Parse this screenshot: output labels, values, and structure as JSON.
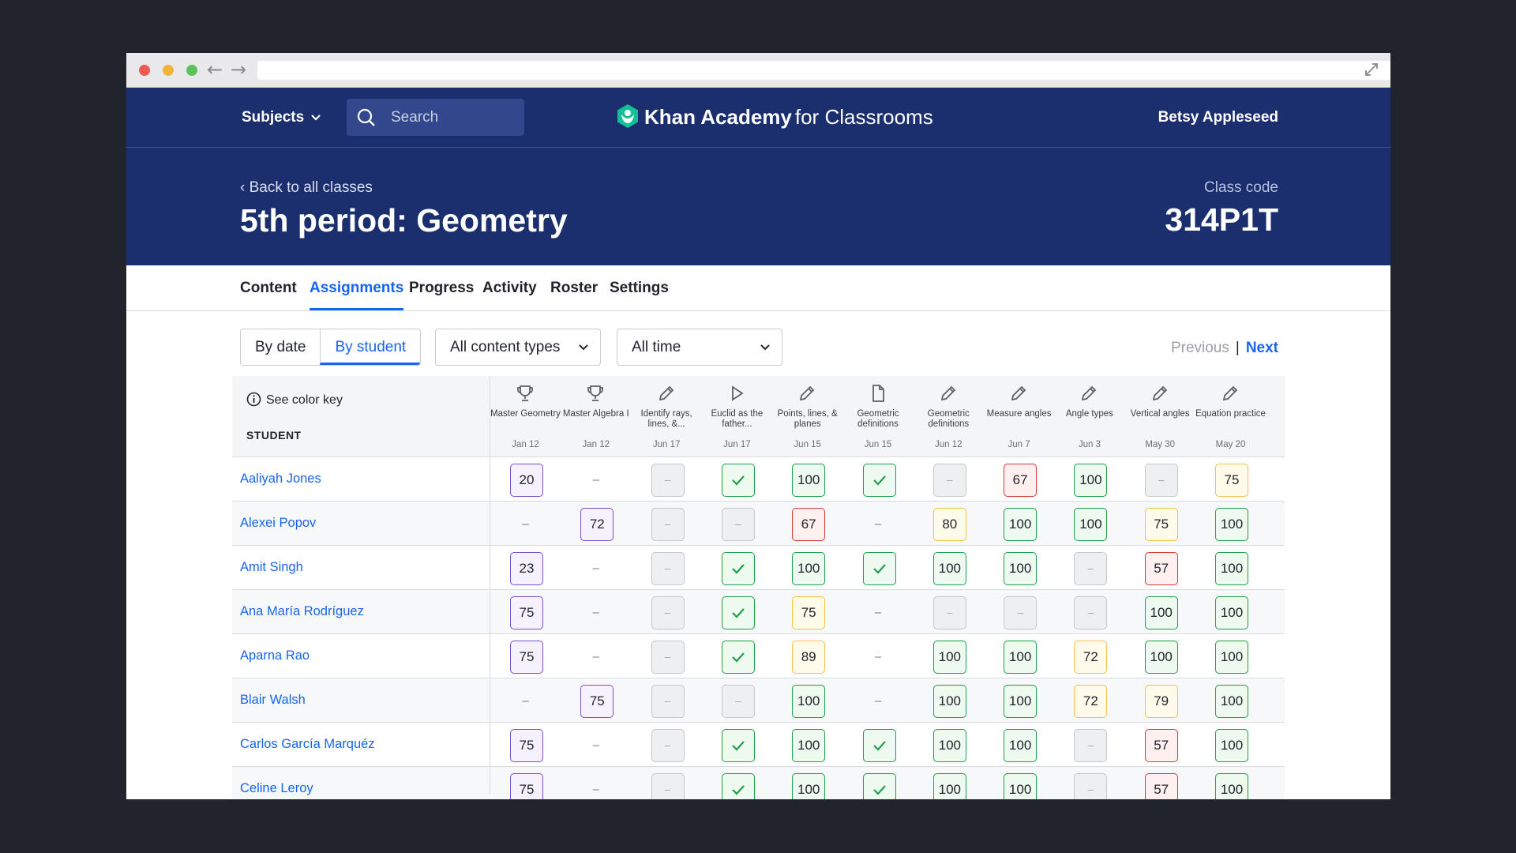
{
  "browser": {
    "url": ""
  },
  "nav": {
    "subjects": "Subjects",
    "search_placeholder": "Search",
    "brand_name": "Khan Academy",
    "brand_suffix": "for Classrooms",
    "user": "Betsy Appleseed"
  },
  "header": {
    "back": "Back to all classes",
    "title": "5th period: Geometry",
    "code_label": "Class code",
    "code_value": "314P1T"
  },
  "tabs": [
    "Content",
    "Assignments",
    "Progress",
    "Activity",
    "Roster",
    "Settings"
  ],
  "active_tab": "Assignments",
  "controls": {
    "by_date": "By date",
    "by_student": "By student",
    "content_types": "All content types",
    "time": "All time",
    "previous": "Previous",
    "separator": "|",
    "next": "Next"
  },
  "table": {
    "color_key": "See color key",
    "student_header": "STUDENT",
    "columns": [
      {
        "icon": "trophy-icon",
        "name": "Master Geometry",
        "date": "Jan 12"
      },
      {
        "icon": "trophy-icon",
        "name": "Master Algebra I",
        "date": "Jan 12"
      },
      {
        "icon": "pencil-icon",
        "name": "Identify rays, lines, &...",
        "date": "Jun 17"
      },
      {
        "icon": "play-icon",
        "name": "Euclid as the father...",
        "date": "Jun 17"
      },
      {
        "icon": "pencil-icon",
        "name": "Points, lines, & planes",
        "date": "Jun 15"
      },
      {
        "icon": "document-icon",
        "name": "Geometric definitions",
        "date": "Jun 15"
      },
      {
        "icon": "pencil-icon",
        "name": "Geometric definitions",
        "date": "Jun 12"
      },
      {
        "icon": "pencil-icon",
        "name": "Measure angles",
        "date": "Jun 7"
      },
      {
        "icon": "pencil-icon",
        "name": "Angle types",
        "date": "Jun 3"
      },
      {
        "icon": "pencil-icon",
        "name": "Vertical angles",
        "date": "May 30"
      },
      {
        "icon": "pencil-icon",
        "name": "Equation practice",
        "date": "May 20"
      }
    ],
    "rows": [
      {
        "name": "Aaliyah Jones",
        "cells": [
          [
            "purple",
            "20"
          ],
          [
            "dash",
            "–"
          ],
          [
            "gray",
            "–"
          ],
          [
            "check",
            ""
          ],
          [
            "green",
            "100"
          ],
          [
            "check",
            ""
          ],
          [
            "gray",
            "–"
          ],
          [
            "red",
            "67"
          ],
          [
            "green",
            "100"
          ],
          [
            "gray",
            "–"
          ],
          [
            "yellow",
            "75"
          ]
        ]
      },
      {
        "name": "Alexei Popov",
        "cells": [
          [
            "dash",
            "–"
          ],
          [
            "purple",
            "72"
          ],
          [
            "gray",
            "–"
          ],
          [
            "gray",
            "–"
          ],
          [
            "red",
            "67"
          ],
          [
            "dash",
            "–"
          ],
          [
            "yellow",
            "80"
          ],
          [
            "green",
            "100"
          ],
          [
            "green",
            "100"
          ],
          [
            "yellow",
            "75"
          ],
          [
            "green",
            "100"
          ]
        ]
      },
      {
        "name": "Amit Singh",
        "cells": [
          [
            "purple",
            "23"
          ],
          [
            "dash",
            "–"
          ],
          [
            "gray",
            "–"
          ],
          [
            "check",
            ""
          ],
          [
            "green",
            "100"
          ],
          [
            "check",
            ""
          ],
          [
            "green",
            "100"
          ],
          [
            "green",
            "100"
          ],
          [
            "gray",
            "–"
          ],
          [
            "red",
            "57"
          ],
          [
            "green",
            "100"
          ]
        ]
      },
      {
        "name": "Ana María Rodríguez",
        "cells": [
          [
            "purple",
            "75"
          ],
          [
            "dash",
            "–"
          ],
          [
            "gray",
            "–"
          ],
          [
            "check",
            ""
          ],
          [
            "yellow",
            "75"
          ],
          [
            "dash",
            "–"
          ],
          [
            "gray",
            "–"
          ],
          [
            "gray",
            "–"
          ],
          [
            "gray",
            "–"
          ],
          [
            "green",
            "100"
          ],
          [
            "green",
            "100"
          ]
        ]
      },
      {
        "name": "Aparna Rao",
        "cells": [
          [
            "purple",
            "75"
          ],
          [
            "dash",
            "–"
          ],
          [
            "gray",
            "–"
          ],
          [
            "check",
            ""
          ],
          [
            "yellow",
            "89"
          ],
          [
            "dash",
            "–"
          ],
          [
            "green",
            "100"
          ],
          [
            "green",
            "100"
          ],
          [
            "yellow",
            "72"
          ],
          [
            "green",
            "100"
          ],
          [
            "green",
            "100"
          ]
        ]
      },
      {
        "name": "Blair Walsh",
        "cells": [
          [
            "dash",
            "–"
          ],
          [
            "purple",
            "75"
          ],
          [
            "gray",
            "–"
          ],
          [
            "gray",
            "–"
          ],
          [
            "green",
            "100"
          ],
          [
            "dash",
            "–"
          ],
          [
            "green",
            "100"
          ],
          [
            "green",
            "100"
          ],
          [
            "yellow",
            "72"
          ],
          [
            "yellow",
            "79"
          ],
          [
            "green",
            "100"
          ]
        ]
      },
      {
        "name": "Carlos García Marquéz",
        "cells": [
          [
            "purple",
            "75"
          ],
          [
            "dash",
            "–"
          ],
          [
            "gray",
            "–"
          ],
          [
            "check",
            ""
          ],
          [
            "green",
            "100"
          ],
          [
            "check",
            ""
          ],
          [
            "green",
            "100"
          ],
          [
            "green",
            "100"
          ],
          [
            "gray",
            "–"
          ],
          [
            "red",
            "57"
          ],
          [
            "green",
            "100"
          ]
        ]
      },
      {
        "name": "Celine Leroy",
        "cells": [
          [
            "purple",
            "75"
          ],
          [
            "dash",
            "–"
          ],
          [
            "gray",
            "–"
          ],
          [
            "check",
            ""
          ],
          [
            "green",
            "100"
          ],
          [
            "check",
            ""
          ],
          [
            "green",
            "100"
          ],
          [
            "green",
            "100"
          ],
          [
            "gray",
            "–"
          ],
          [
            "red",
            "57"
          ],
          [
            "green",
            "100"
          ]
        ]
      }
    ]
  },
  "colors": {
    "navy": "#1b2f6f",
    "blue": "#1865f2",
    "green": "#1f9f4a",
    "red": "#d23b3b",
    "yellow": "#f2c14a",
    "purple": "#7c4dcc"
  }
}
